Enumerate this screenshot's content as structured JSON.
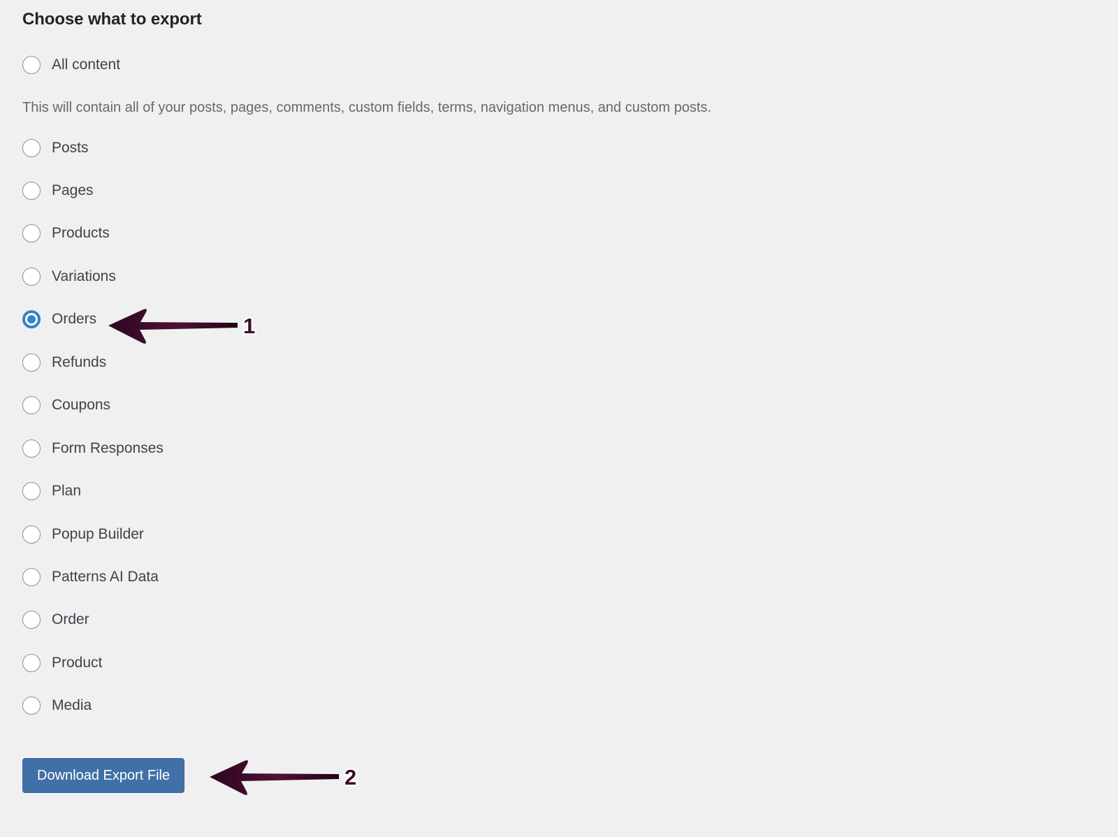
{
  "page": {
    "title": "Choose what to export",
    "background_color": "#f0f0f1",
    "helper_text": "This will contain all of your posts, pages, comments, custom fields, terms, navigation menus, and custom posts."
  },
  "options": [
    {
      "label": "All content",
      "selected": false
    },
    {
      "label": "Posts",
      "selected": false
    },
    {
      "label": "Pages",
      "selected": false
    },
    {
      "label": "Products",
      "selected": false
    },
    {
      "label": "Variations",
      "selected": false
    },
    {
      "label": "Orders",
      "selected": true
    },
    {
      "label": "Refunds",
      "selected": false
    },
    {
      "label": "Coupons",
      "selected": false
    },
    {
      "label": "Form Responses",
      "selected": false
    },
    {
      "label": "Plan",
      "selected": false
    },
    {
      "label": "Popup Builder",
      "selected": false
    },
    {
      "label": "Patterns AI Data",
      "selected": false
    },
    {
      "label": "Order",
      "selected": false
    },
    {
      "label": "Product",
      "selected": false
    },
    {
      "label": "Media",
      "selected": false
    }
  ],
  "selected_option": "Orders",
  "button": {
    "label": "Download Export File",
    "color": "#4170a8",
    "text_color": "#ffffff"
  },
  "annotations": {
    "color": "#3d0a28",
    "items": [
      {
        "number": "1",
        "points_at": "Orders"
      },
      {
        "number": "2",
        "points_at": "Download Export File"
      }
    ]
  }
}
